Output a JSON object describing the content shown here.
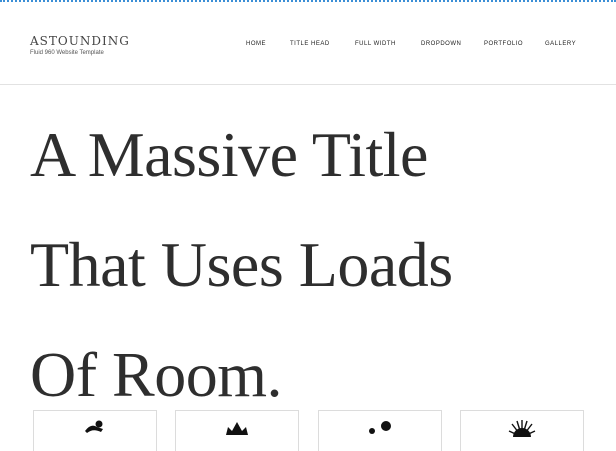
{
  "header": {
    "logo": "ASTOUNDING",
    "tagline": "Fluid 960 Website Template"
  },
  "nav": {
    "items": [
      "Home",
      "Title Head",
      "Full Width",
      "Dropdown",
      "Portfolio",
      "Gallery"
    ]
  },
  "hero": {
    "lines": [
      "A Massive Title",
      "That Uses Loads",
      "Of Room."
    ]
  },
  "feature_boxes": {
    "icons": [
      "swimmer-icon",
      "crown-icon",
      "dots-icon",
      "sunburst-icon"
    ]
  },
  "colors": {
    "top_rule": "#3b8fd6",
    "text": "#2e2e2e",
    "border": "#dcdcdc"
  }
}
